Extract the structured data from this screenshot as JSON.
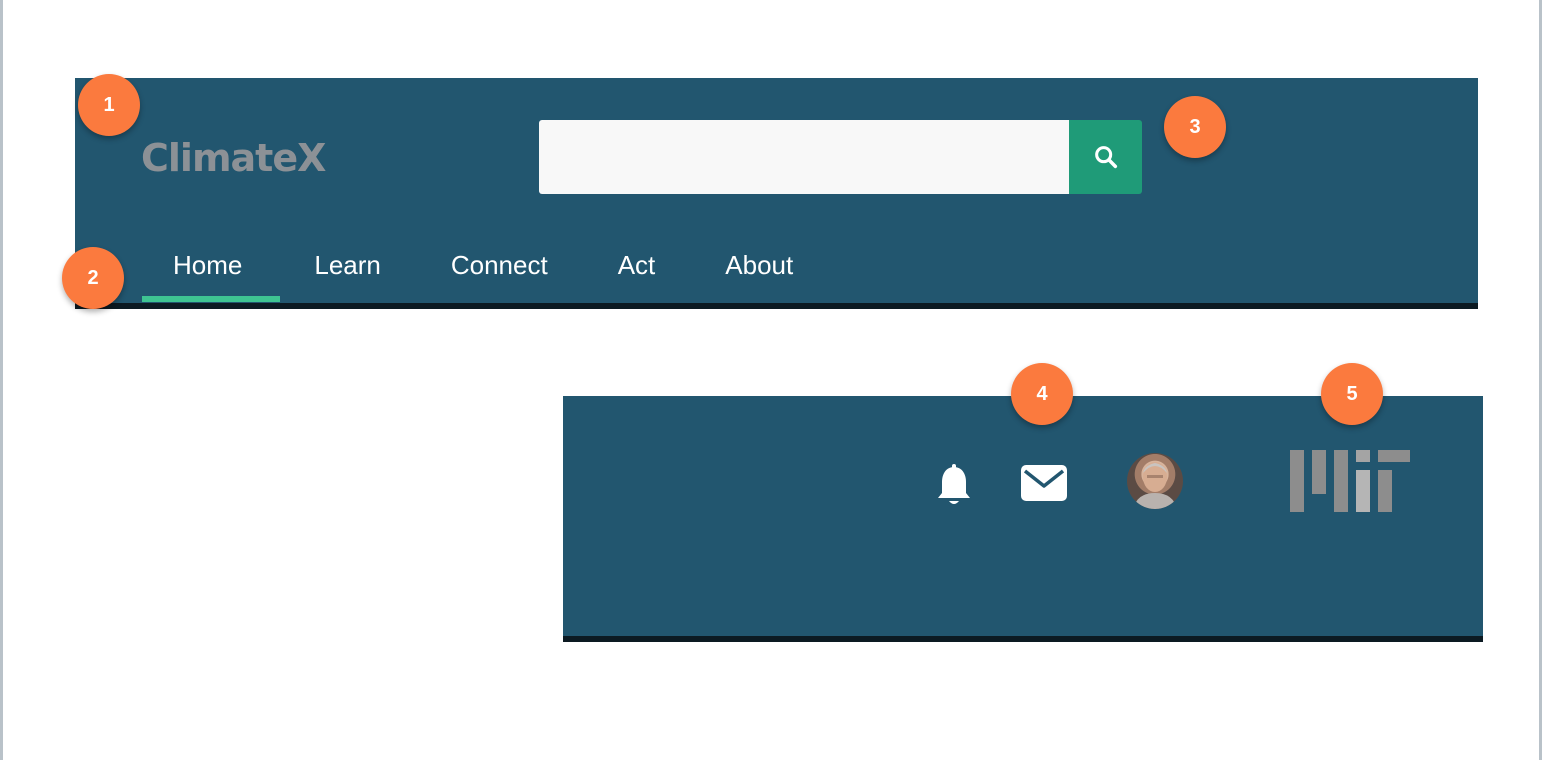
{
  "header": {
    "logo_text": "ClimateX",
    "search": {
      "value": "",
      "placeholder": ""
    },
    "nav": [
      {
        "label": "Home",
        "active": true
      },
      {
        "label": "Learn",
        "active": false
      },
      {
        "label": "Connect",
        "active": false
      },
      {
        "label": "Act",
        "active": false
      },
      {
        "label": "About",
        "active": false
      }
    ]
  },
  "user_bar": {
    "icons": [
      "bell-icon",
      "mail-icon",
      "user-avatar",
      "mit-logo"
    ]
  },
  "callouts": [
    "1",
    "2",
    "3",
    "4",
    "5"
  ],
  "colors": {
    "bar_background": "#22566f",
    "search_button": "#1f9b78",
    "active_tab_underline": "#3ec492",
    "callout": "#fb7a3e",
    "logo": "#8c9196"
  }
}
